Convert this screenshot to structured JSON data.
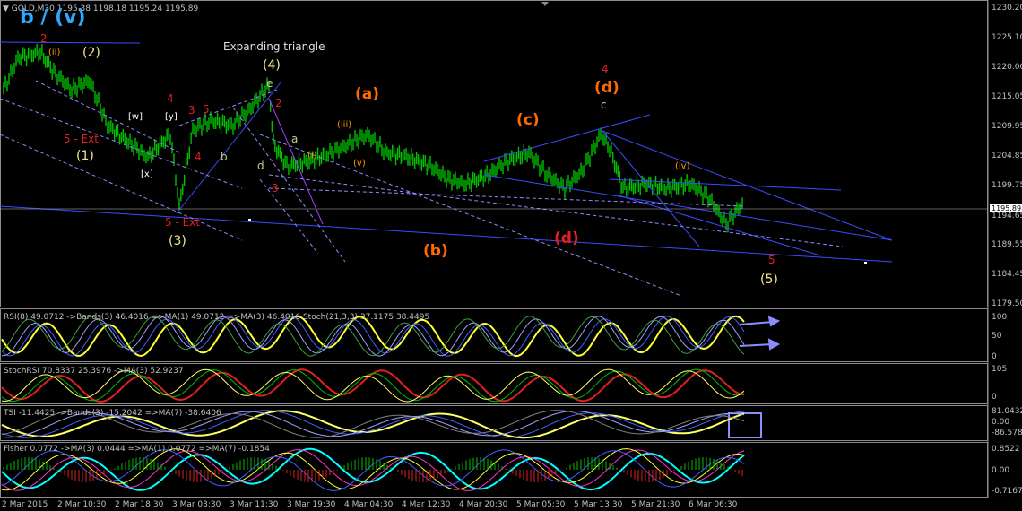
{
  "chart_header": {
    "symbol_label": "GOLD,M30",
    "ohlc": "1195.38 1198.18 1195.24 1195.89",
    "big_wave_label": "b / (v)"
  },
  "main_axis": {
    "ticks": [
      "1230.20",
      "1225.10",
      "1220.00",
      "1215.05",
      "1209.95",
      "1204.85",
      "1199.75",
      "1194.80",
      "1189.55",
      "1184.45",
      "1179.50"
    ],
    "current_price": "1195.89",
    "extra_tick": "1194.65"
  },
  "annotations": {
    "expanding_triangle": "Expanding triangle",
    "w4": "(4)",
    "w1": "(1)",
    "w2": "(2)",
    "w3": "(3)",
    "w5": "(5)",
    "wa": "(a)",
    "wb": "(b)",
    "wc": "(c)",
    "wd": "(d)",
    "wd2": "(d)",
    "ext1": "5 - Ext",
    "ext2": "5 - Ext",
    "red4a": "4",
    "red4b": "4",
    "red2a": "2",
    "red2b": "2",
    "red3a": "3",
    "red3b": "3",
    "red5a": "5",
    "red5b": "5",
    "red4c": "4",
    "e": "e",
    "d": "d",
    "b": "b",
    "a": "a",
    "c": "c",
    "ww": "[w]",
    "wy": "[y]",
    "wx": "[x]",
    "ii": "(ii)",
    "iii": "(iii)",
    "iv": "(iv)",
    "v": "(v)",
    "i": "(i)"
  },
  "panel1": {
    "header": "RSI(8) 49.0712  ->Bands(3) 46.4016  =>MA(1) 49.0712  =>MA(3) 46.4016  Stoch(21,3,3) 37.1175 38.4495",
    "ticks": [
      "100",
      "50",
      "0"
    ]
  },
  "panel2": {
    "header": "StochRSI 70.8337 25.3976  ->MA(3) 52.9237",
    "ticks": [
      "105",
      "0"
    ]
  },
  "panel3": {
    "header": "TSI -11.4425  ->Bands(3) -15.2042  =>MA(7) -38.6406",
    "ticks": [
      "81.0432",
      "0.00",
      "-86.5782"
    ]
  },
  "panel4": {
    "header": "Fisher 0.0772  ->MA(3) 0.0444  =>MA(1) 0.0772  =>MA(7) -0.1854",
    "ticks": [
      "0.8522",
      "0.00",
      "-0.7167"
    ]
  },
  "x_axis": [
    "2 Mar 2015",
    "2 Mar 10:30",
    "2 Mar 18:30",
    "3 Mar 03:30",
    "3 Mar 11:30",
    "3 Mar 19:30",
    "4 Mar 04:30",
    "4 Mar 12:30",
    "4 Mar 20:30",
    "5 Mar 05:30",
    "5 Mar 13:30",
    "5 Mar 21:30",
    "6 Mar 06:30"
  ],
  "colors": {
    "background": "#000000",
    "bull_bear": "#00c000",
    "trendline": "#3a4cff",
    "wave_orange": "#ff6a00",
    "wave_yellow": "#f0e68c",
    "wave_red": "#e02020",
    "wave_magenta": "#ff44ff",
    "wave_green": "#b8d38a"
  }
}
